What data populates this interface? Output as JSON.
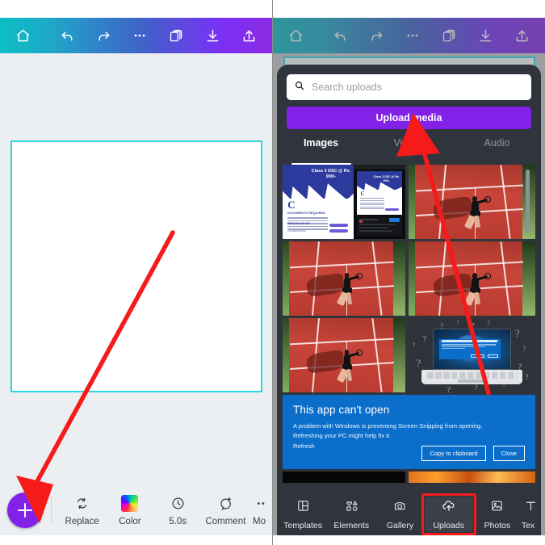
{
  "app": {
    "name": "Mobile design editor",
    "accent_purple": "#8222e8",
    "accent_teal": "#0bbfc4",
    "annotation_color": "#f51b1b"
  },
  "toolbar": {
    "home_icon": "home-icon",
    "undo_icon": "undo-icon",
    "redo_icon": "redo-icon",
    "more_icon": "more-horizontal-icon",
    "duplicate_icon": "duplicate-pages-icon",
    "download_icon": "download-icon",
    "share_icon": "share-icon"
  },
  "left_pane": {
    "canvas_label": "blank-canvas",
    "action_bar": {
      "add_label": "+",
      "items": [
        {
          "label": "Replace",
          "icon": "replace-icon"
        },
        {
          "label": "Color",
          "icon": "color-wheel-icon"
        },
        {
          "label": "5.0s",
          "icon": "duration-clock-icon"
        },
        {
          "label": "Comment",
          "icon": "comment-add-icon"
        },
        {
          "label": "Mo",
          "icon": "more-horizontal-icon"
        }
      ]
    }
  },
  "right_pane": {
    "search": {
      "placeholder": "Search uploads",
      "value": "",
      "icon": "search-icon"
    },
    "upload_button": {
      "label": "Upload media"
    },
    "tabs": [
      {
        "label": "Images",
        "active": true
      },
      {
        "label": "Videos",
        "active": false
      },
      {
        "label": "Audio",
        "active": false
      }
    ],
    "uploads": [
      {
        "name": "poster-thumbnail",
        "type": "document-design"
      },
      {
        "name": "tennis-photo-1",
        "type": "photo"
      },
      {
        "name": "tennis-photo-2",
        "type": "photo"
      },
      {
        "name": "tennis-photo-3",
        "type": "photo"
      },
      {
        "name": "laptop-error-illustration",
        "type": "illustration"
      },
      {
        "name": "windows-error-screenshot",
        "type": "screenshot"
      },
      {
        "name": "black-thumbnail",
        "type": "photo"
      },
      {
        "name": "fire-thumbnail",
        "type": "photo"
      }
    ],
    "poster_thumbnail": {
      "headline": "Class 3 DSC @ Rs. 900/-",
      "sub_headline": "Class 3 DSC @ Rs. 900/-",
      "logo_letter": "C",
      "logo_word": "Corporatefilance",
      "section_title": "DOCUMENTS REQUIRED",
      "contact_title": "REACH US AT:",
      "phone": "+91 8100733342",
      "email": "corporatefilance@gmail.com",
      "website": "http://corporatefilance.in"
    },
    "windows_dialog": {
      "title": "This app can't open",
      "body": "A problem with Windows is preventing Screen Snipping from opening. Refreshing your PC might help fix it.",
      "link": "Refresh",
      "buttons": [
        "Copy to clipboard",
        "Close"
      ]
    },
    "bottom_nav": [
      {
        "label": "Templates",
        "icon": "templates-icon",
        "active": false
      },
      {
        "label": "Elements",
        "icon": "elements-shapes-icon",
        "active": false
      },
      {
        "label": "Gallery",
        "icon": "camera-gallery-icon",
        "active": false
      },
      {
        "label": "Uploads",
        "icon": "cloud-upload-icon",
        "active": true
      },
      {
        "label": "Photos",
        "icon": "photo-image-icon",
        "active": false
      },
      {
        "label": "Tex",
        "icon": "text-icon",
        "active": false
      }
    ]
  },
  "annotations": [
    {
      "name": "arrow-to-add-button",
      "target": "add-button"
    },
    {
      "name": "arrow-to-upload-media",
      "target": "upload-media-button"
    },
    {
      "name": "highlight-box-uploads-tab",
      "target": "nav-item-uploads"
    }
  ]
}
